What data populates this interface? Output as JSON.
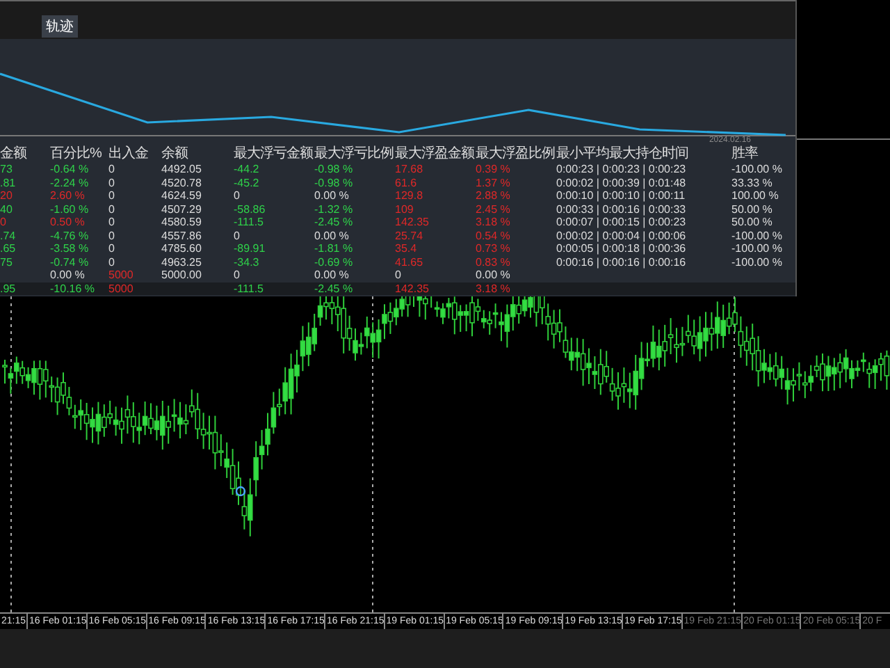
{
  "panel": {
    "tab": {
      "label": "轨迹",
      "selected": true
    },
    "chart_date": "2024.02.16",
    "table": {
      "columns": [
        "金额",
        "百分比%",
        "出入金",
        "余额",
        "最大浮亏金额",
        "最大浮亏比例",
        "最大浮盈金额",
        "最大浮盈比例",
        "最小平均最大持仓时间",
        "胜率"
      ],
      "rows": [
        {
          "amount": {
            "text": "73",
            "color": "#2fd24a"
          },
          "percent": {
            "text": "-0.64 %",
            "color": "#2fd24a"
          },
          "deposit": {
            "text": "0",
            "color": "#dddddd"
          },
          "balance": {
            "text": "4492.05",
            "color": "#dddddd"
          },
          "max_loss_amount": {
            "text": "-44.2",
            "color": "#2fd24a"
          },
          "max_loss_ratio": {
            "text": "-0.98 %",
            "color": "#2fd24a"
          },
          "max_profit_amount": {
            "text": "17.68",
            "color": "#e02828"
          },
          "max_profit_ratio": {
            "text": "0.39 %",
            "color": "#e02828"
          },
          "hold_times": {
            "text": "0:00:23 | 0:00:23 | 0:00:23",
            "color": "#dddddd"
          },
          "win_rate": {
            "text": "-100.00 %",
            "color": "#dddddd"
          }
        },
        {
          "amount": {
            "text": ".81",
            "color": "#2fd24a"
          },
          "percent": {
            "text": "-2.24 %",
            "color": "#2fd24a"
          },
          "deposit": {
            "text": "0",
            "color": "#dddddd"
          },
          "balance": {
            "text": "4520.78",
            "color": "#dddddd"
          },
          "max_loss_amount": {
            "text": "-45.2",
            "color": "#2fd24a"
          },
          "max_loss_ratio": {
            "text": "-0.98 %",
            "color": "#2fd24a"
          },
          "max_profit_amount": {
            "text": "61.6",
            "color": "#e02828"
          },
          "max_profit_ratio": {
            "text": "1.37 %",
            "color": "#e02828"
          },
          "hold_times": {
            "text": "0:00:02 | 0:00:39 | 0:01:48",
            "color": "#dddddd"
          },
          "win_rate": {
            "text": "33.33 %",
            "color": "#dddddd"
          }
        },
        {
          "amount": {
            "text": "20",
            "color": "#e02828"
          },
          "percent": {
            "text": "2.60 %",
            "color": "#e02828"
          },
          "deposit": {
            "text": "0",
            "color": "#dddddd"
          },
          "balance": {
            "text": "4624.59",
            "color": "#dddddd"
          },
          "max_loss_amount": {
            "text": "0",
            "color": "#dddddd"
          },
          "max_loss_ratio": {
            "text": "0.00 %",
            "color": "#dddddd"
          },
          "max_profit_amount": {
            "text": "129.8",
            "color": "#e02828"
          },
          "max_profit_ratio": {
            "text": "2.88 %",
            "color": "#e02828"
          },
          "hold_times": {
            "text": "0:00:10 | 0:00:10 | 0:00:11",
            "color": "#dddddd"
          },
          "win_rate": {
            "text": "100.00 %",
            "color": "#dddddd"
          }
        },
        {
          "amount": {
            "text": "40",
            "color": "#2fd24a"
          },
          "percent": {
            "text": "-1.60 %",
            "color": "#2fd24a"
          },
          "deposit": {
            "text": "0",
            "color": "#dddddd"
          },
          "balance": {
            "text": "4507.29",
            "color": "#dddddd"
          },
          "max_loss_amount": {
            "text": "-58.86",
            "color": "#2fd24a"
          },
          "max_loss_ratio": {
            "text": "-1.32 %",
            "color": "#2fd24a"
          },
          "max_profit_amount": {
            "text": "109",
            "color": "#e02828"
          },
          "max_profit_ratio": {
            "text": "2.45 %",
            "color": "#e02828"
          },
          "hold_times": {
            "text": "0:00:33 | 0:00:16 | 0:00:33",
            "color": "#dddddd"
          },
          "win_rate": {
            "text": "50.00 %",
            "color": "#dddddd"
          }
        },
        {
          "amount": {
            "text": "0",
            "color": "#e02828"
          },
          "percent": {
            "text": "0.50 %",
            "color": "#e02828"
          },
          "deposit": {
            "text": "0",
            "color": "#dddddd"
          },
          "balance": {
            "text": "4580.59",
            "color": "#dddddd"
          },
          "max_loss_amount": {
            "text": "-111.5",
            "color": "#2fd24a"
          },
          "max_loss_ratio": {
            "text": "-2.45 %",
            "color": "#2fd24a"
          },
          "max_profit_amount": {
            "text": "142.35",
            "color": "#e02828"
          },
          "max_profit_ratio": {
            "text": "3.18 %",
            "color": "#e02828"
          },
          "hold_times": {
            "text": "0:00:07 | 0:00:15 | 0:00:23",
            "color": "#dddddd"
          },
          "win_rate": {
            "text": "50.00 %",
            "color": "#dddddd"
          }
        },
        {
          "amount": {
            "text": ".74",
            "color": "#2fd24a"
          },
          "percent": {
            "text": "-4.76 %",
            "color": "#2fd24a"
          },
          "deposit": {
            "text": "0",
            "color": "#dddddd"
          },
          "balance": {
            "text": "4557.86",
            "color": "#dddddd"
          },
          "max_loss_amount": {
            "text": "0",
            "color": "#dddddd"
          },
          "max_loss_ratio": {
            "text": "0.00 %",
            "color": "#dddddd"
          },
          "max_profit_amount": {
            "text": "25.74",
            "color": "#e02828"
          },
          "max_profit_ratio": {
            "text": "0.54 %",
            "color": "#e02828"
          },
          "hold_times": {
            "text": "0:00:02 | 0:00:04 | 0:00:06",
            "color": "#dddddd"
          },
          "win_rate": {
            "text": "-100.00 %",
            "color": "#dddddd"
          }
        },
        {
          "amount": {
            "text": ".65",
            "color": "#2fd24a"
          },
          "percent": {
            "text": "-3.58 %",
            "color": "#2fd24a"
          },
          "deposit": {
            "text": "0",
            "color": "#dddddd"
          },
          "balance": {
            "text": "4785.60",
            "color": "#dddddd"
          },
          "max_loss_amount": {
            "text": "-89.91",
            "color": "#2fd24a"
          },
          "max_loss_ratio": {
            "text": "-1.81 %",
            "color": "#2fd24a"
          },
          "max_profit_amount": {
            "text": "35.4",
            "color": "#e02828"
          },
          "max_profit_ratio": {
            "text": "0.73 %",
            "color": "#e02828"
          },
          "hold_times": {
            "text": "0:00:05 | 0:00:18 | 0:00:36",
            "color": "#dddddd"
          },
          "win_rate": {
            "text": "-100.00 %",
            "color": "#dddddd"
          }
        },
        {
          "amount": {
            "text": "75",
            "color": "#2fd24a"
          },
          "percent": {
            "text": "-0.74 %",
            "color": "#2fd24a"
          },
          "deposit": {
            "text": "0",
            "color": "#dddddd"
          },
          "balance": {
            "text": "4963.25",
            "color": "#dddddd"
          },
          "max_loss_amount": {
            "text": "-34.3",
            "color": "#2fd24a"
          },
          "max_loss_ratio": {
            "text": "-0.69 %",
            "color": "#2fd24a"
          },
          "max_profit_amount": {
            "text": "41.65",
            "color": "#e02828"
          },
          "max_profit_ratio": {
            "text": "0.83 %",
            "color": "#e02828"
          },
          "hold_times": {
            "text": "0:00:16 | 0:00:16 | 0:00:16",
            "color": "#dddddd"
          },
          "win_rate": {
            "text": "-100.00 %",
            "color": "#dddddd"
          }
        },
        {
          "percent": {
            "text": "0.00 %",
            "color": "#dddddd"
          },
          "deposit": {
            "text": "5000",
            "color": "#e02828"
          },
          "balance": {
            "text": "5000.00",
            "color": "#dddddd"
          },
          "max_loss_amount": {
            "text": "0",
            "color": "#dddddd"
          },
          "max_loss_ratio": {
            "text": "0.00 %",
            "color": "#dddddd"
          },
          "max_profit_amount": {
            "text": "0",
            "color": "#dddddd"
          },
          "max_profit_ratio": {
            "text": "0.00 %",
            "color": "#dddddd"
          }
        }
      ],
      "total": {
        "amount": {
          "text": ".95",
          "color": "#2fd24a"
        },
        "percent": {
          "text": "-10.16 %",
          "color": "#2fd24a"
        },
        "deposit": {
          "text": "5000",
          "color": "#e02828"
        },
        "max_loss_amount": {
          "text": "-111.5",
          "color": "#2fd24a"
        },
        "max_loss_ratio": {
          "text": "-2.45 %",
          "color": "#2fd24a"
        },
        "max_profit_amount": {
          "text": "142.35",
          "color": "#e02828"
        },
        "max_profit_ratio": {
          "text": "3.18 %",
          "color": "#e02828"
        }
      }
    }
  },
  "time_axis": [
    {
      "label": "21:15",
      "dim": false
    },
    {
      "label": "16 Feb 01:15",
      "dim": false
    },
    {
      "label": "16 Feb 05:15",
      "dim": false
    },
    {
      "label": "16 Feb 09:15",
      "dim": false
    },
    {
      "label": "16 Feb 13:15",
      "dim": false
    },
    {
      "label": "16 Feb 17:15",
      "dim": false
    },
    {
      "label": "16 Feb 21:15",
      "dim": false
    },
    {
      "label": "19 Feb 01:15",
      "dim": false
    },
    {
      "label": "19 Feb 05:15",
      "dim": false
    },
    {
      "label": "19 Feb 09:15",
      "dim": false
    },
    {
      "label": "19 Feb 13:15",
      "dim": false
    },
    {
      "label": "19 Feb 17:15",
      "dim": false
    },
    {
      "label": "19 Feb 21:15",
      "dim": true
    },
    {
      "label": "20 Feb 01:15",
      "dim": true
    },
    {
      "label": "20 Feb 05:15",
      "dim": true
    },
    {
      "label": "20 F",
      "dim": true
    }
  ]
}
